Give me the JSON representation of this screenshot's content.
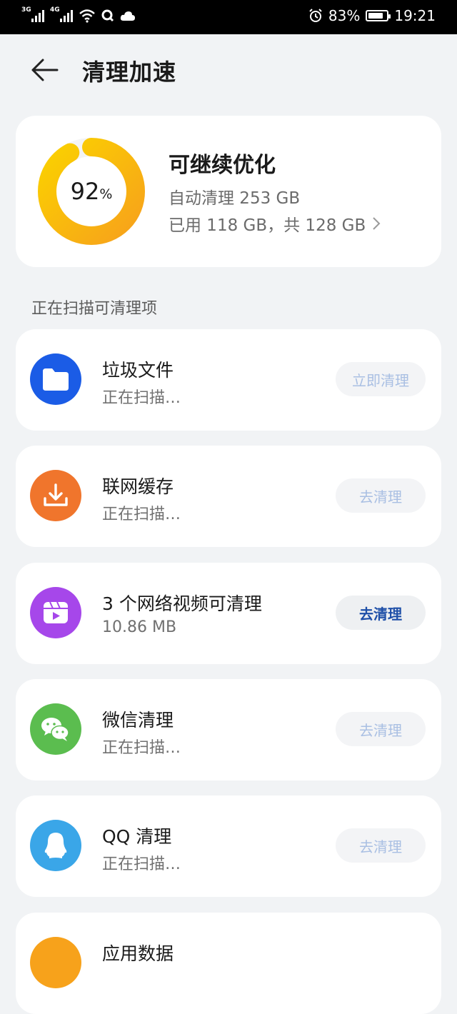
{
  "status_bar": {
    "signal1": "3G",
    "signal2": "4G",
    "battery": "83%",
    "battery_level": 0.83,
    "time": "19:21"
  },
  "header": {
    "title": "清理加速"
  },
  "summary": {
    "percent_number": "92",
    "percent_sign": "%",
    "usage_fraction": 0.92,
    "title": "可继续优化",
    "auto_clean": "自动清理 253 GB",
    "storage": "已用 118 GB，共 128 GB",
    "ring_colors": [
      "#f7a21b",
      "#fbd100"
    ]
  },
  "section_label": "正在扫描可清理项",
  "items": [
    {
      "name": "垃圾文件",
      "status": "正在扫描…",
      "button": "立即清理",
      "icon": "folder-icon",
      "color": "#1b5ce6"
    },
    {
      "name": "联网缓存",
      "status": "正在扫描…",
      "button": "去清理",
      "icon": "download-icon",
      "color": "#f0752c"
    },
    {
      "name": "3 个网络视频可清理",
      "status": "10.86 MB",
      "button": "去清理",
      "icon": "video-icon",
      "color": "#a647ea"
    },
    {
      "name": "微信清理",
      "status": "正在扫描…",
      "button": "去清理",
      "icon": "wechat-icon",
      "color": "#5bbd4f"
    },
    {
      "name": "QQ 清理",
      "status": "正在扫描…",
      "button": "去清理",
      "icon": "qq-icon",
      "color": "#3aa6e8"
    },
    {
      "name": "应用数据",
      "icon": "app-data-icon",
      "color": "#f7a21b"
    }
  ]
}
